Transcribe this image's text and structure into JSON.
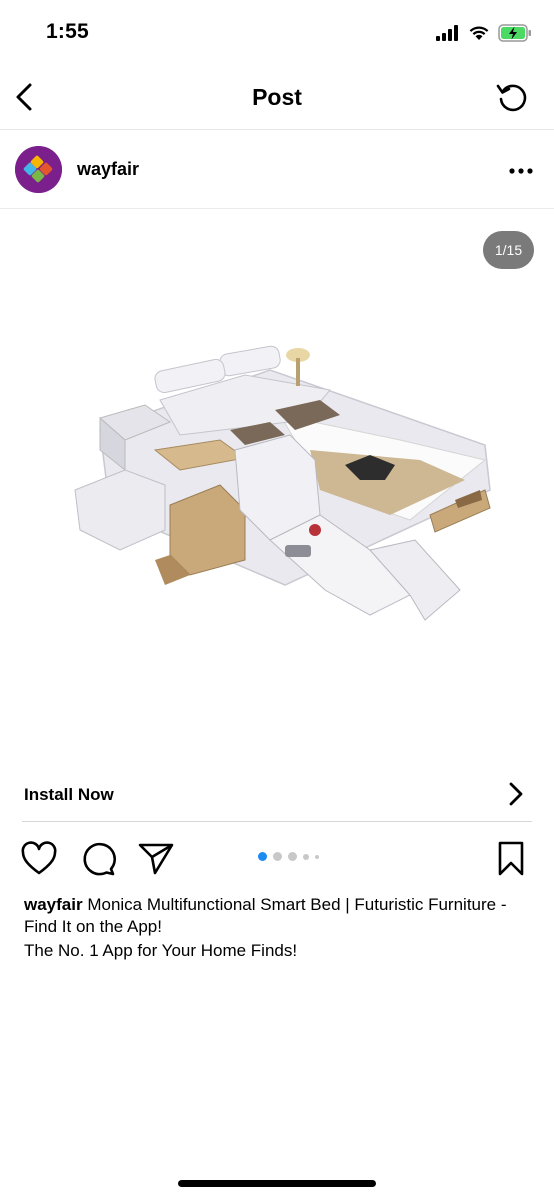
{
  "status_bar": {
    "time": "1:55",
    "icons": [
      "signal-icon",
      "wifi-icon",
      "battery-charging-icon"
    ]
  },
  "nav": {
    "title": "Post",
    "back_icon": "back-chevron-icon",
    "refresh_icon": "refresh-icon"
  },
  "post": {
    "account": "wayfair",
    "more_icon": "more-horizontal-icon",
    "page_counter": "1/15",
    "carousel": {
      "current_index": 1,
      "total": 15
    },
    "install_cta": "Install Now",
    "caption": {
      "user": "wayfair",
      "text": "Monica Multifunctional Smart Bed | Futuristic Furniture - Find It on the App!",
      "line2": "The No. 1 App for Your Home Finds!"
    }
  },
  "colors": {
    "accent_blue": "#1a8bf0",
    "avatar_purple": "#7b1f8c",
    "battery_green": "#4cd964"
  }
}
